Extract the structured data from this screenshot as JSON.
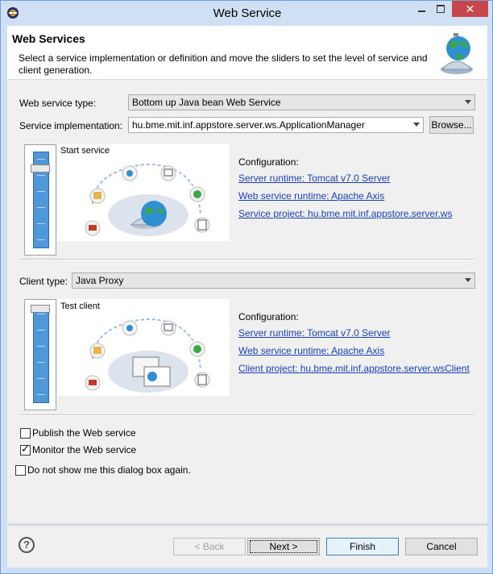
{
  "window": {
    "title": "Web Service",
    "close_glyph": "✕"
  },
  "banner": {
    "title": "Web Services",
    "description": "Select a service implementation or definition and move the sliders to set the level of service and client generation.",
    "icon": "globe-bell-icon"
  },
  "service": {
    "type_label": "Web service type:",
    "type_value": "Bottom up Java bean Web Service",
    "impl_label": "Service implementation:",
    "impl_value": "hu.bme.mit.inf.appstore.server.ws.ApplicationManager",
    "browse_label": "Browse...",
    "slider_level": "Start service",
    "config_label": "Configuration:",
    "links": [
      "Server runtime: Tomcat v7.0 Server",
      "Web service runtime: Apache Axis",
      "Service project: hu.bme.mit.inf.appstore.server.ws"
    ]
  },
  "client": {
    "type_label": "Client type:",
    "type_value": "Java Proxy",
    "slider_level": "Test client",
    "config_label": "Configuration:",
    "links": [
      "Server runtime: Tomcat v7.0 Server",
      "Web service runtime: Apache Axis",
      "Client project: hu.bme.mit.inf.appstore.server.wsClient"
    ]
  },
  "options": {
    "publish": {
      "label": "Publish the Web service",
      "checked": false
    },
    "monitor": {
      "label": "Monitor the Web service",
      "checked": true
    },
    "dont_show": {
      "label": "Do not show me this dialog box again.",
      "checked": false
    }
  },
  "footer": {
    "help": "?",
    "back": "< Back",
    "next": "Next >",
    "finish": "Finish",
    "cancel": "Cancel"
  }
}
